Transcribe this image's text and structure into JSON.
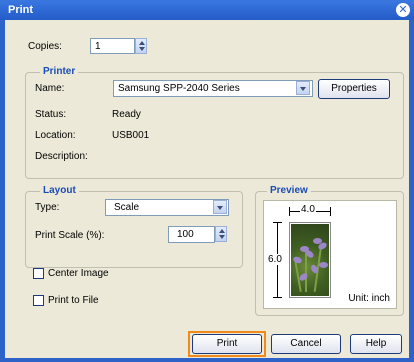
{
  "window": {
    "title": "Print"
  },
  "copies": {
    "label": "Copies:",
    "value": "1"
  },
  "printer": {
    "legend": "Printer",
    "name_label": "Name:",
    "name_value": "Samsung SPP-2040 Series",
    "properties_label": "Properties",
    "status_label": "Status:",
    "status_value": "Ready",
    "location_label": "Location:",
    "location_value": "USB001",
    "description_label": "Description:"
  },
  "layout": {
    "legend": "Layout",
    "type_label": "Type:",
    "type_value": "Scale",
    "scale_label": "Print Scale (%):",
    "scale_value": "100"
  },
  "options": {
    "center_image_label": "Center Image",
    "print_to_file_label": "Print to File"
  },
  "preview": {
    "legend": "Preview",
    "width_label": "4.0",
    "height_label": "6.0",
    "unit_label": "Unit: inch"
  },
  "buttons": {
    "print": "Print",
    "cancel": "Cancel",
    "help": "Help"
  },
  "colors": {
    "title_bar": "#2f62c9",
    "accent": "#1a4cb5",
    "highlight": "#f08a1c"
  }
}
